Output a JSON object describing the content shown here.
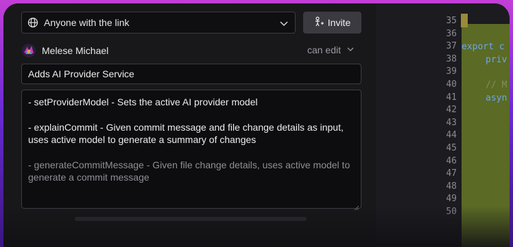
{
  "share": {
    "visibility_value": "Anyone with the link",
    "invite_label": "Invite"
  },
  "member": {
    "name": "Melese Michael",
    "permission": "can edit"
  },
  "pr": {
    "title": "Adds AI Provider Service",
    "description": [
      "- setProviderModel - Sets the active AI provider model",
      "- explainCommit - Given commit message and file change details as input, uses active model to generate a summary of changes",
      "- generateCommitMessage - Given file change details, uses active model to generate a commit message"
    ]
  },
  "editor": {
    "line_numbers": [
      "35",
      "36",
      "37",
      "38",
      "39",
      "40",
      "41",
      "42",
      "43",
      "44",
      "45",
      "46",
      "47",
      "48",
      "49",
      "50"
    ],
    "code_fragments": {
      "l37": "export c",
      "l38": "priv",
      "l40": "// M",
      "l41": "asyn"
    }
  },
  "colors": {
    "accent_gradient_top": "#c23fd6",
    "accent_gradient_bottom": "#3a1680",
    "panel_bg": "#18181b",
    "code_green": "#5b6a25"
  }
}
